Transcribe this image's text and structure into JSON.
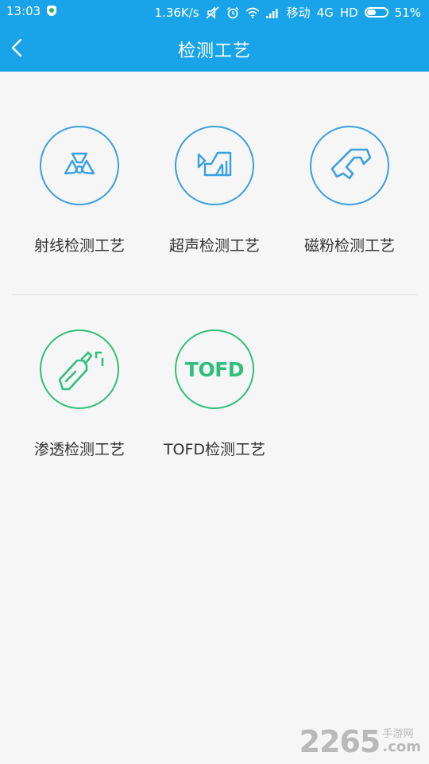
{
  "status_bar": {
    "time": "13:03",
    "speed": "1.36K/s",
    "carrier": "移动",
    "network": "4G",
    "hd": "HD",
    "battery_percent": "51%",
    "battery_level": 0.51,
    "icons": [
      "shield-icon",
      "mute-icon",
      "alarm-icon",
      "wifi-icon",
      "signal-icon",
      "battery-icon"
    ]
  },
  "header": {
    "title": "检测工艺",
    "back_icon": "back-arrow-icon"
  },
  "processes": [
    {
      "label": "射线检测工艺",
      "icon": "radiation-icon",
      "color": "#3aa0de"
    },
    {
      "label": "超声检测工艺",
      "icon": "ultrasonic-icon",
      "color": "#3aa0de"
    },
    {
      "label": "磁粉检测工艺",
      "icon": "magnet-yoke-icon",
      "color": "#3aa0de"
    },
    {
      "label": "渗透检测工艺",
      "icon": "spray-can-icon",
      "color": "#2fbf7c"
    },
    {
      "label": "TOFD检测工艺",
      "icon": "tofd-text-icon",
      "icon_text": "TOFD",
      "color": "#2fbf7c"
    }
  ],
  "watermark": {
    "number": "2265",
    "text": "手游网",
    "domain": ".com"
  },
  "colors": {
    "primary": "#19a3e8",
    "icon_blue": "#3aa0de",
    "icon_green": "#2fbf7c",
    "background": "#f6f6f6"
  }
}
